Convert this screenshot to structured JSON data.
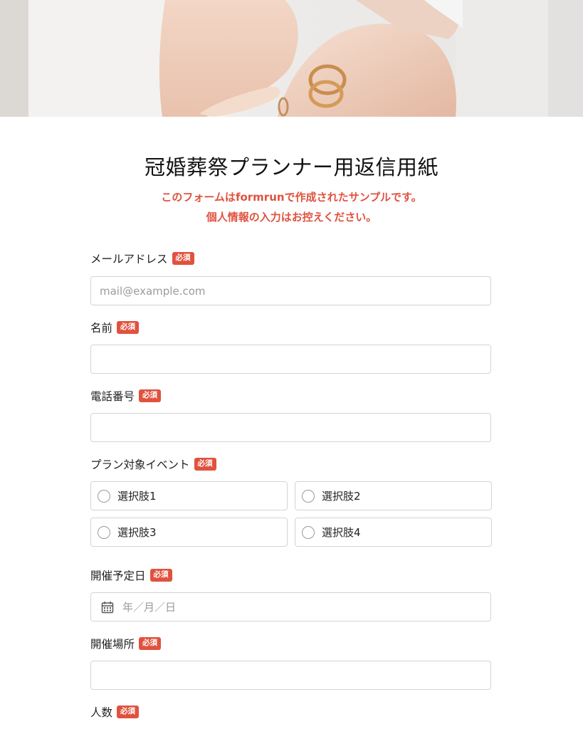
{
  "form": {
    "title": "冠婚葬祭プランナー用返信用紙",
    "notice_line1_pre": "このフォームは",
    "notice_line1_brand": "formrun",
    "notice_line1_post": "で作成されたサンプルです。",
    "notice_line2": "個人情報の入力はお控えください。",
    "required_badge": "必須"
  },
  "fields": {
    "email": {
      "label": "メールアドレス",
      "placeholder": "mail@example.com",
      "value": ""
    },
    "name": {
      "label": "名前",
      "value": ""
    },
    "phone": {
      "label": "電話番号",
      "value": ""
    },
    "plan_event": {
      "label": "プラン対象イベント",
      "options": [
        "選択肢1",
        "選択肢2",
        "選択肢3",
        "選択肢4"
      ]
    },
    "event_date": {
      "label": "開催予定日",
      "placeholder": "年／月／日"
    },
    "venue": {
      "label": "開催場所",
      "value": ""
    },
    "attendees": {
      "label": "人数"
    }
  },
  "colors": {
    "accent": "#e0523e",
    "border": "#d4d4d4",
    "placeholder": "#9b9b9b"
  },
  "icons": {
    "date_field": "calendar-icon",
    "radio": "radio-circle-icon"
  }
}
